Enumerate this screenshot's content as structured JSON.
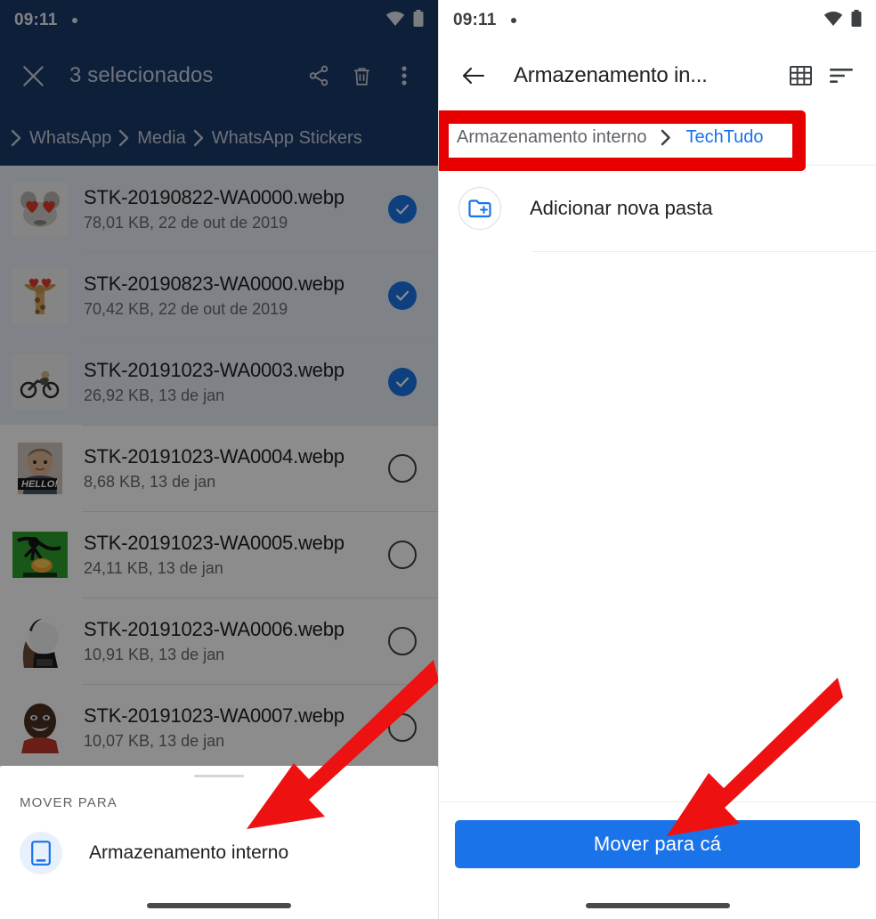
{
  "left_panel": {
    "status_bar": {
      "time": "09:11",
      "wifi_icon": "wifi-icon",
      "battery_icon": "battery-icon",
      "dot_icon": "notification-dot-icon"
    },
    "toolbar": {
      "close_icon": "close-icon",
      "selection_count": "3 selecionados",
      "share_icon": "share-icon",
      "delete_icon": "trash-icon",
      "overflow_icon": "more-vertical-icon"
    },
    "breadcrumb": {
      "leading_icon": "chevron-right-icon",
      "items": [
        "WhatsApp",
        "Media",
        "WhatsApp Stickers"
      ],
      "separator": "›"
    },
    "files": [
      {
        "name": "STK-20190822-WA0000.webp",
        "meta": "78,01 KB, 22 de out de 2019",
        "selected": true,
        "thumb": "mouse-hearts-sticker"
      },
      {
        "name": "STK-20190823-WA0000.webp",
        "meta": "70,42 KB, 22 de out de 2019",
        "selected": true,
        "thumb": "giraffe-hearts-sticker"
      },
      {
        "name": "STK-20191023-WA0003.webp",
        "meta": "26,92 KB, 13 de jan",
        "selected": true,
        "thumb": "motorcycle-sticker"
      },
      {
        "name": "STK-20191023-WA0004.webp",
        "meta": "8,68 KB, 13 de jan",
        "selected": false,
        "thumb": "hello-man-sticker"
      },
      {
        "name": "STK-20191023-WA0005.webp",
        "meta": "24,11 KB, 13 de jan",
        "selected": false,
        "thumb": "green-meme-sticker"
      },
      {
        "name": "STK-20191023-WA0006.webp",
        "meta": "10,91 KB, 13 de jan",
        "selected": false,
        "thumb": "white-hood-sticker"
      },
      {
        "name": "STK-20191023-WA0007.webp",
        "meta": "10,07 KB, 13 de jan",
        "selected": false,
        "thumb": "smiling-man-sticker"
      }
    ],
    "bottom_sheet": {
      "section_label": "MOVER PARA",
      "item_icon": "phone-storage-icon",
      "item_label": "Armazenamento interno"
    }
  },
  "right_panel": {
    "status_bar": {
      "time": "09:11",
      "wifi_icon": "wifi-icon",
      "battery_icon": "battery-icon",
      "dot_icon": "notification-dot-icon"
    },
    "toolbar": {
      "back_icon": "arrow-left-icon",
      "title": "Armazenamento in...",
      "grid_icon": "grid-view-icon",
      "sort_icon": "sort-icon"
    },
    "breadcrumb": {
      "root": "Armazenamento interno",
      "separator": "›",
      "current": "TechTudo"
    },
    "add_folder": {
      "icon": "create-new-folder-icon",
      "label": "Adicionar nova pasta"
    },
    "move_button_label": "Mover para cá"
  },
  "annotations": {
    "highlight_color": "#e60000",
    "arrow_color": "#ee1111",
    "arrow_left_name": "arrow-pointing-to-internal-storage",
    "arrow_right_name": "arrow-pointing-to-move-here-button"
  },
  "colors": {
    "toolbar_blue": "#1a3a6b",
    "accent_blue": "#1a73e8",
    "selected_row": "#e8edf5",
    "scrim": "rgba(0,0,0,0.45)"
  }
}
